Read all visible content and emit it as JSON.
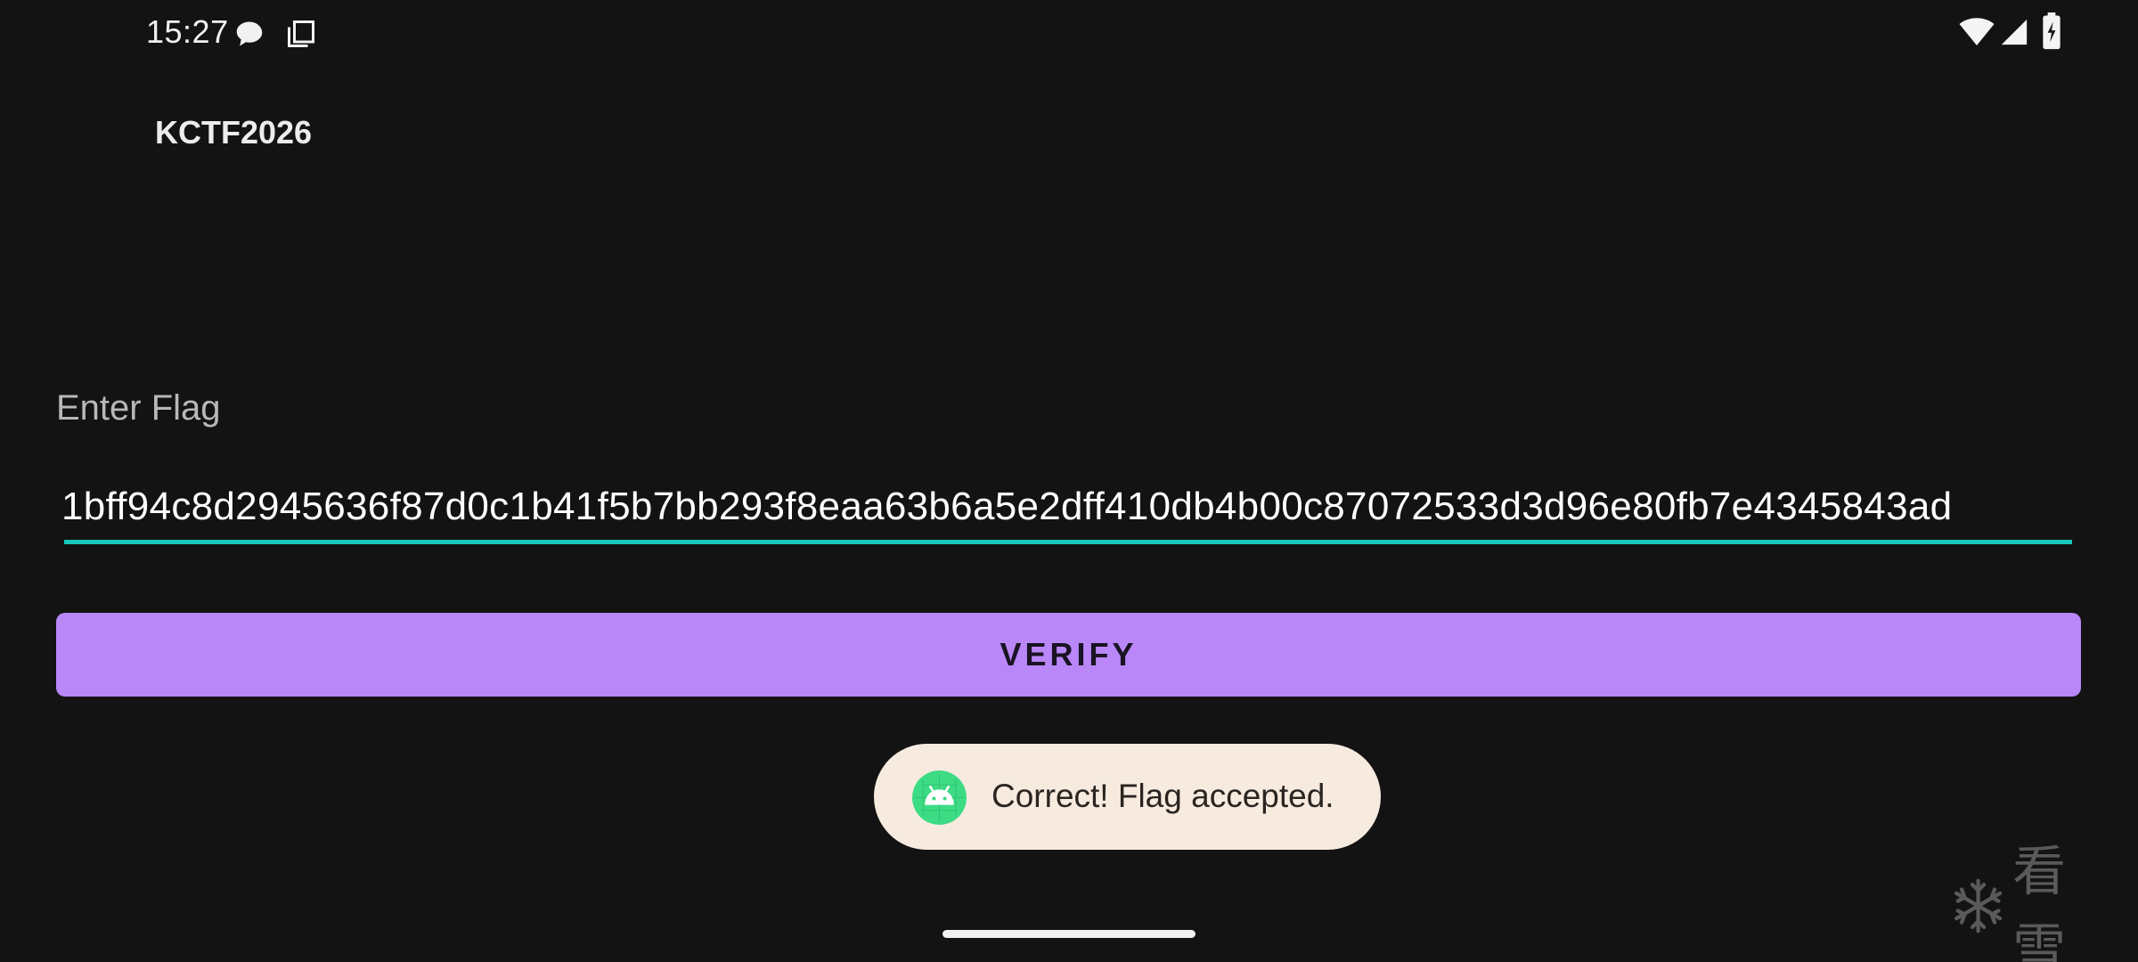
{
  "status_bar": {
    "time": "15:27",
    "icons": [
      "chat-bubble-icon",
      "copy-icon",
      "wifi-icon",
      "cell-signal-icon",
      "battery-charging-icon"
    ]
  },
  "app": {
    "title": "KCTF2026"
  },
  "form": {
    "label": "Enter Flag",
    "flag_value": "1bff94c8d2945636f87d0c1b41f5b7bb293f8eaa63b6a5e2dff410db4b00c87072533d3d96e80fb7e4345843ad",
    "verify_label": "VERIFY"
  },
  "toast": {
    "icon": "android-icon",
    "message": "Correct! Flag accepted."
  },
  "watermark": {
    "text": "看雪",
    "icon": "snowflake-icon"
  },
  "colors": {
    "background": "#131313",
    "accent_button": "#b987f8",
    "input_underline": "#17c8b8",
    "toast_background": "#f7ebe0",
    "android_green": "#3ddc84"
  }
}
